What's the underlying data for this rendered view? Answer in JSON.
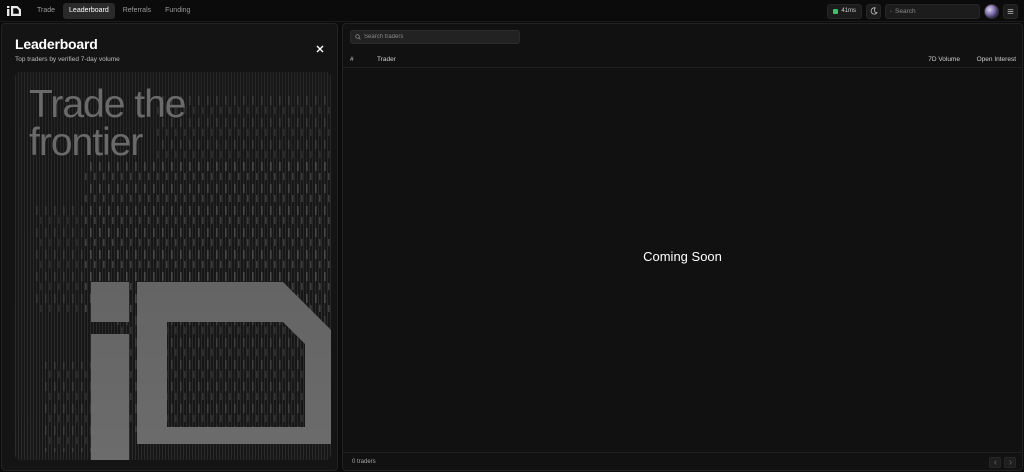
{
  "nav": {
    "items": [
      {
        "label": "Trade",
        "active": false
      },
      {
        "label": "Leaderboard",
        "active": true
      },
      {
        "label": "Referrals",
        "active": false
      },
      {
        "label": "Funding",
        "active": false
      }
    ]
  },
  "toolbar": {
    "latency": "41ms",
    "latency_color": "#32c56b",
    "search_placeholder": "Search",
    "theme_icon": "moon-icon",
    "menu_icon": "hamburger-menu-icon"
  },
  "leaderboard": {
    "title": "Leaderboard",
    "subtitle": "Top traders by verified 7-day volume",
    "promo_line1": "Trade the",
    "promo_line2": "frontier"
  },
  "table": {
    "search_placeholder": "Search traders",
    "columns": {
      "rank": "#",
      "trader": "Trader",
      "volume": "7D Volume",
      "open_interest": "Open Interest"
    },
    "empty_message": "Coming Soon",
    "trader_count": "0 traders"
  }
}
